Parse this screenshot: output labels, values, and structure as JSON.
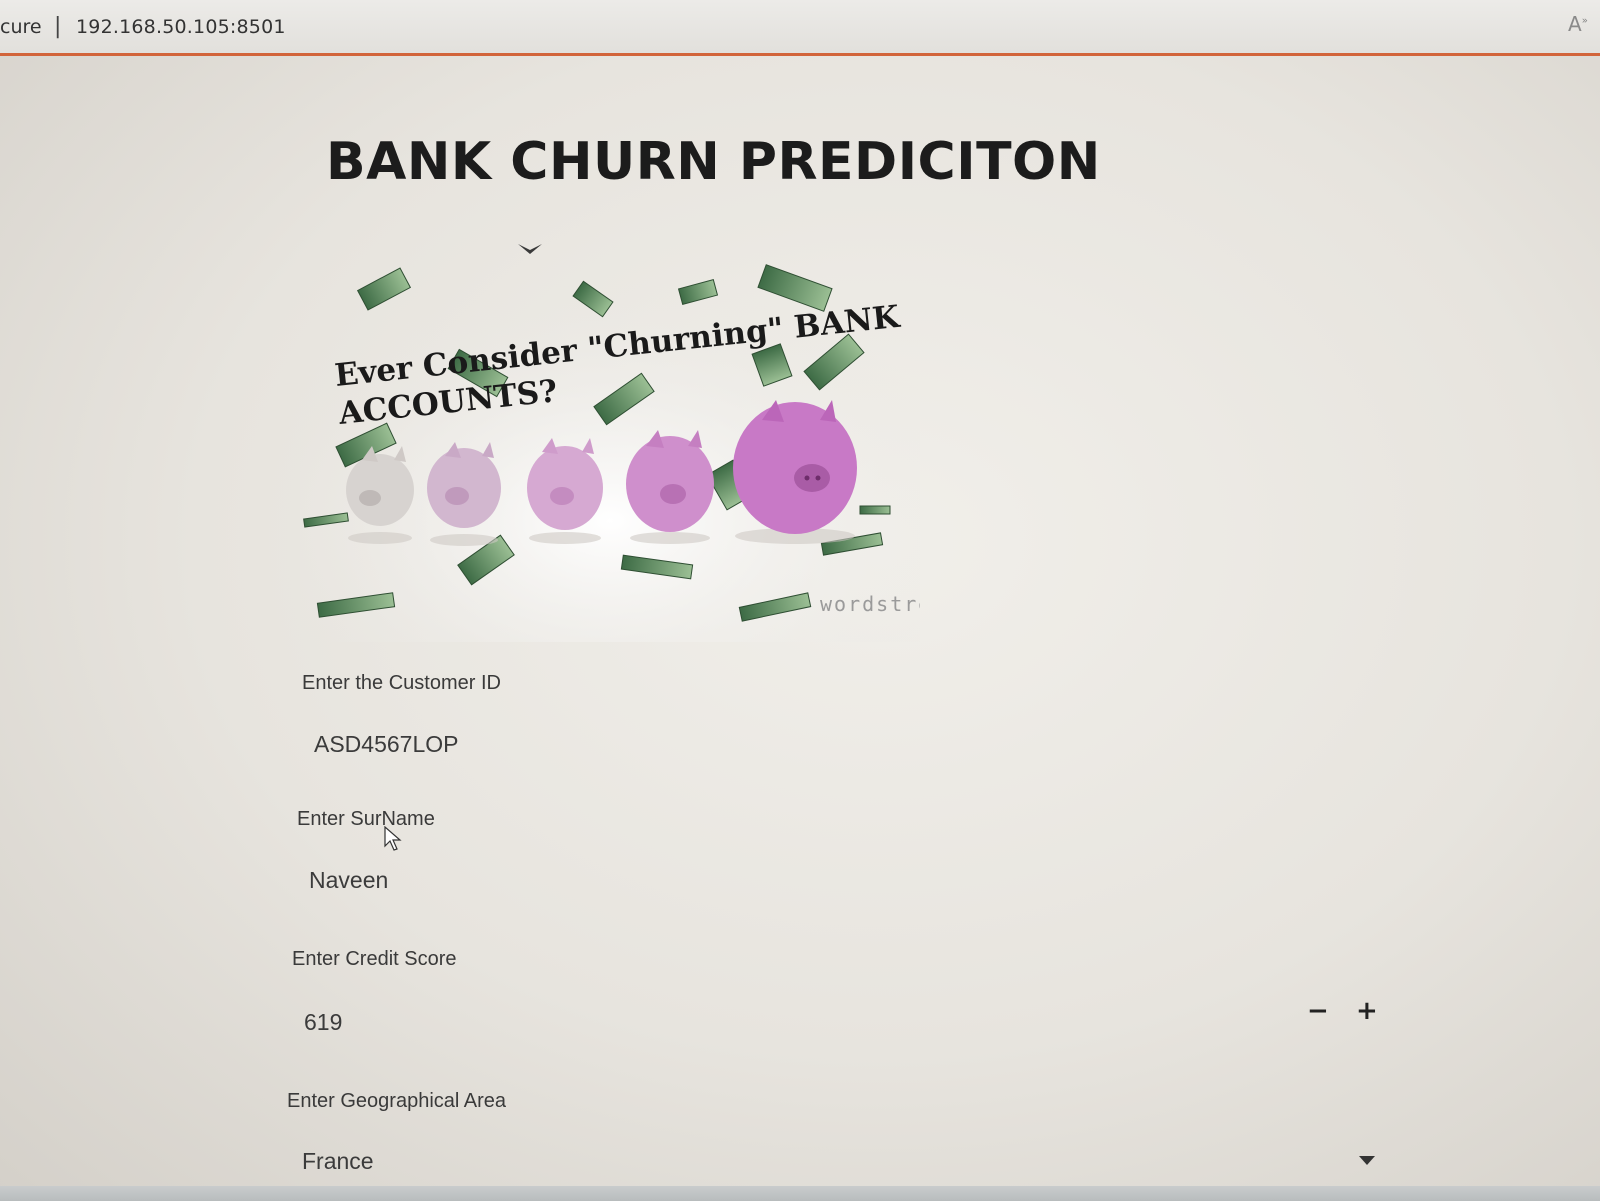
{
  "browser": {
    "secure_text": "cure",
    "separator": "|",
    "url": "192.168.50.105:8501",
    "read_aloud_icon": "read-aloud-icon"
  },
  "page": {
    "title": "BANK CHURN PREDICITON"
  },
  "hero_image": {
    "caption_line1": "Ever Consider \"Churning\" BANK",
    "caption_line2": "ACCOUNTS?",
    "watermark": "wordstream",
    "description_icon": "piggy-banks-image"
  },
  "form": {
    "customer_id": {
      "label": "Enter the Customer ID",
      "value": "ASD4567LOP"
    },
    "surname": {
      "label": "Enter SurName",
      "value": "Naveen"
    },
    "credit_score": {
      "label": "Enter Credit Score",
      "value": "619",
      "minus": "−",
      "plus": "+"
    },
    "geography": {
      "label": "Enter Geographical Area",
      "value": "France"
    }
  }
}
